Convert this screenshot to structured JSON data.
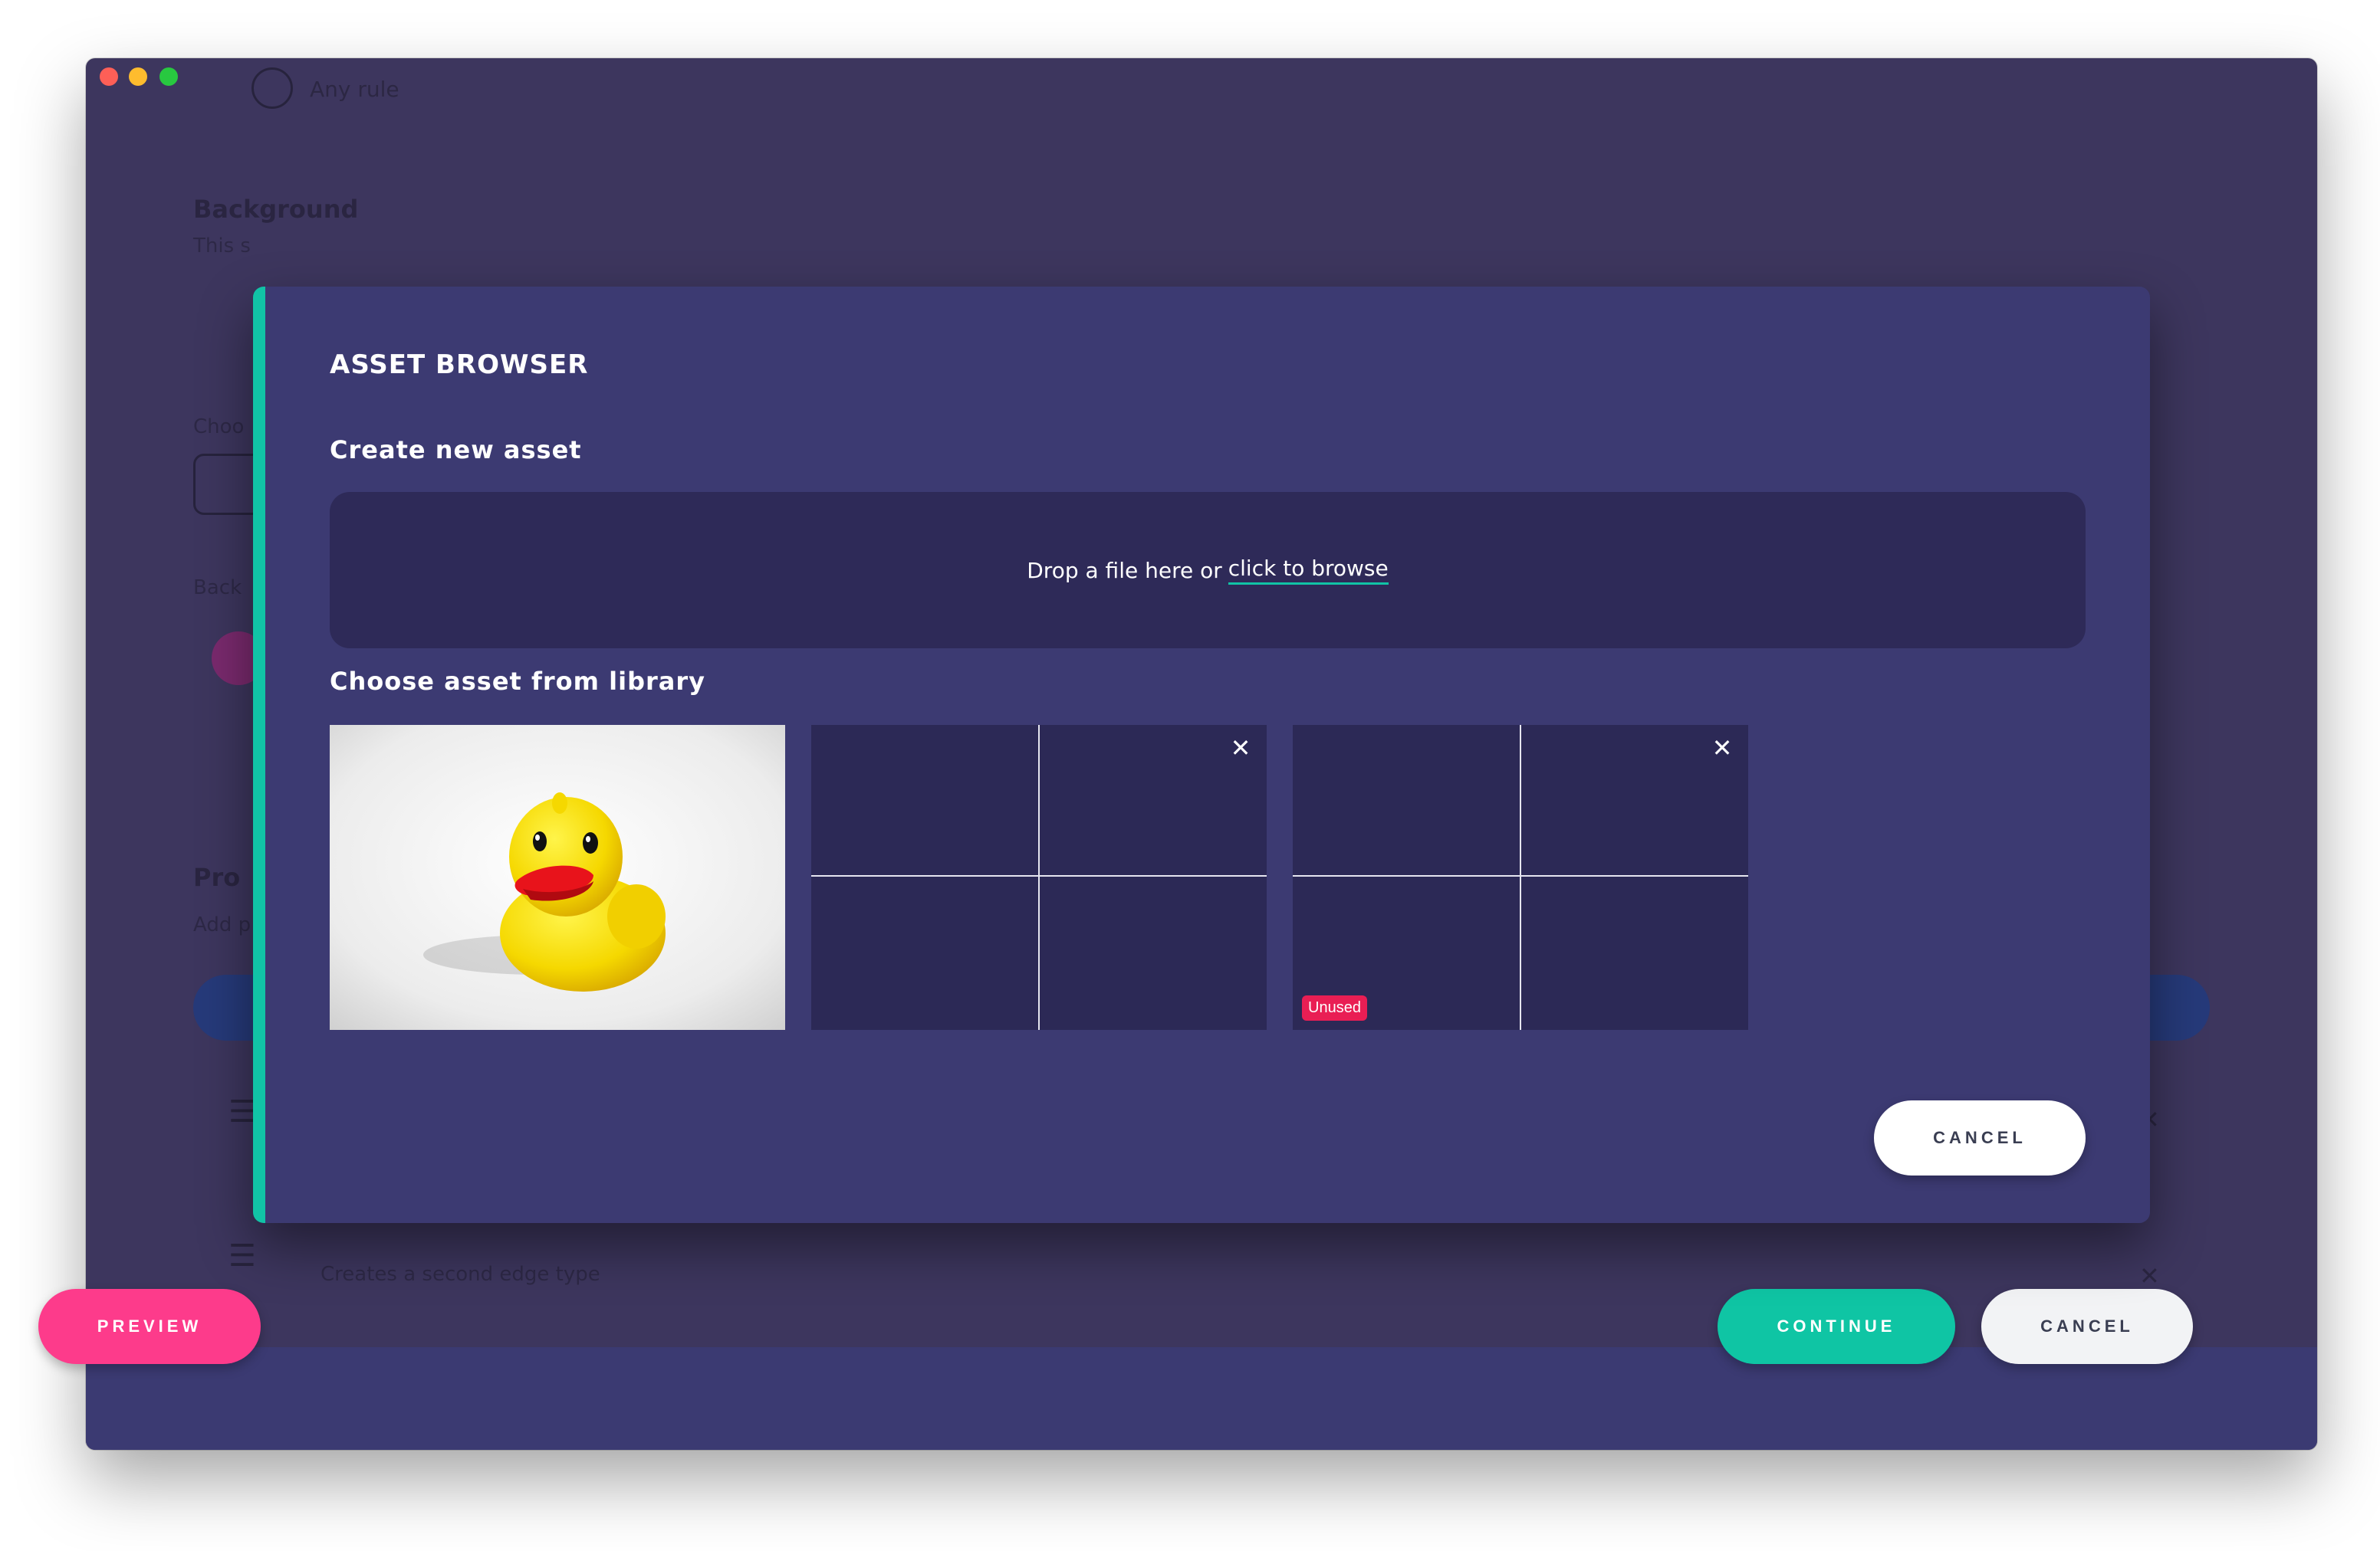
{
  "background": {
    "rule_label": "Any rule",
    "section_heading": "Background",
    "section_text": "This s",
    "choose_label": "Choo",
    "back_label": "Back",
    "prompts_heading": "Pro",
    "add_text": "Add p",
    "list_item_text": "Creates a second edge type"
  },
  "modal": {
    "title": "ASSET BROWSER",
    "create_label": "Create new asset",
    "drop_text": "Drop a file here or",
    "browse_link": "click to browse",
    "library_label": "Choose asset from library",
    "assets": [
      {
        "kind": "image",
        "name": "rubber-duck"
      },
      {
        "kind": "placeholder",
        "badge": ""
      },
      {
        "kind": "placeholder",
        "badge": "Unused"
      }
    ],
    "cancel_label": "CANCEL"
  },
  "footer": {
    "preview_label": "PREVIEW",
    "continue_label": "CONTINUE",
    "cancel_label": "CANCEL"
  },
  "colors": {
    "accent": "#11c3a6",
    "preview": "#fd3b8b",
    "badge": "#e91e54",
    "modal_bg": "#3c3a72"
  }
}
